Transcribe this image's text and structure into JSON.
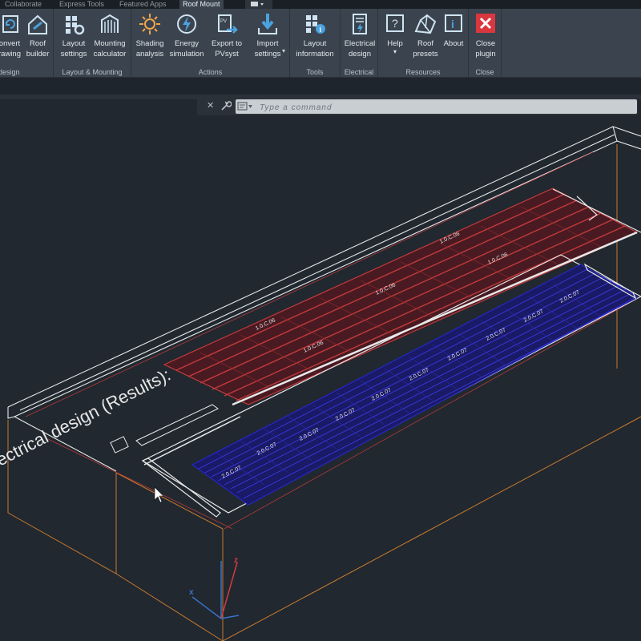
{
  "tabs": [
    {
      "label": "Collaborate"
    },
    {
      "label": "Express Tools"
    },
    {
      "label": "Featured Apps"
    },
    {
      "label": "Roof Mount"
    }
  ],
  "ribbon": {
    "groups": [
      {
        "label": "design",
        "buttons": [
          {
            "label1": "onvert",
            "label2": "rawing"
          },
          {
            "label1": "Roof",
            "label2": "builder"
          }
        ]
      },
      {
        "label": "Layout & Mounting",
        "buttons": [
          {
            "label1": "Layout",
            "label2": "settings"
          },
          {
            "label1": "Mounting",
            "label2": "calculator"
          }
        ]
      },
      {
        "label": "Actions",
        "buttons": [
          {
            "label1": "Shading",
            "label2": "analysis"
          },
          {
            "label1": "Energy",
            "label2": "simulation"
          },
          {
            "label1": "Export to",
            "label2": "PVsyst"
          },
          {
            "label1": "Import",
            "label2": "settings"
          }
        ]
      },
      {
        "label": "Tools",
        "buttons": [
          {
            "label1": "Layout",
            "label2": "information"
          }
        ]
      },
      {
        "label": "Electrical",
        "buttons": [
          {
            "label1": "Electrical",
            "label2": "design"
          }
        ]
      },
      {
        "label": "Resources",
        "buttons": [
          {
            "label1": "Help",
            "label2": ""
          },
          {
            "label1": "Roof",
            "label2": "presets"
          },
          {
            "label1": "About",
            "label2": ""
          }
        ]
      },
      {
        "label": "Close",
        "buttons": [
          {
            "label1": "Close",
            "label2": "plugin"
          }
        ]
      }
    ]
  },
  "command": {
    "placeholder": "Type a command"
  },
  "viewport": {
    "annotation": "ectrical design (Results):",
    "string_labels_red": [
      "1.0.C.06",
      "1.0.C.06",
      "1.0.C.06",
      "1.0.C.06",
      "1.0.C.06"
    ],
    "string_labels_blue": [
      "2.0.C.07",
      "2.0.C.07",
      "2.0.C.07",
      "2.0.C.07",
      "2.0.C.07",
      "2.0.C.07",
      "2.0.C.07",
      "2.0.C.07",
      "2.0.C.07",
      "2.0.C.07"
    ],
    "colors": {
      "background": "#212830",
      "red_array": "#c23b3b",
      "blue_array": "#2626c8",
      "outline": "#e8e8e8",
      "orange_edge": "#c97a2c",
      "axis_x": "#d63a3a",
      "axis_y": "#3b72c9"
    }
  }
}
